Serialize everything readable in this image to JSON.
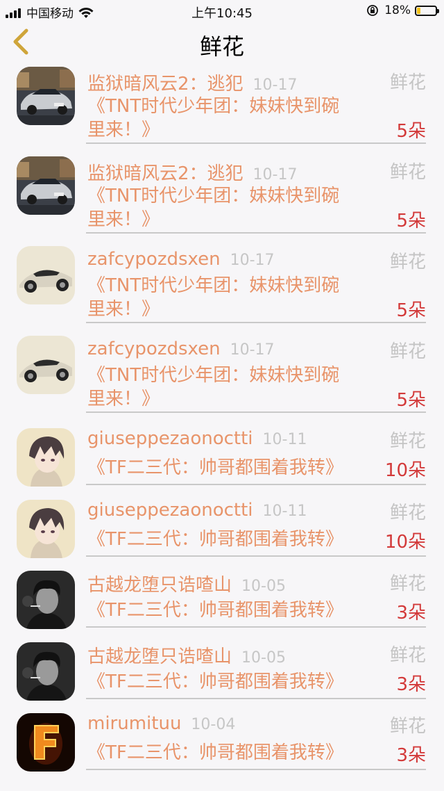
{
  "status_bar": {
    "carrier": "中国移动",
    "time": "上午10:45",
    "battery_percent": "18%",
    "battery_level": 0.18
  },
  "nav": {
    "title": "鲜花",
    "back_icon": "chevron-left-icon",
    "accent": "#cfa53a"
  },
  "colors": {
    "name": "#e8946a",
    "content": "#e8946a",
    "count": "#d33a3a",
    "muted": "#c4c4c4"
  },
  "rows": [
    {
      "name": "监狱暗风云2：逃犯",
      "date": "10-17",
      "gift": "鲜花",
      "content1": "《TNT时代少年团：妹妹快到碗",
      "content2": "里来！》",
      "count": "5朵",
      "avatar": "car-silver-avatar"
    },
    {
      "name": "监狱暗风云2：逃犯",
      "date": "10-17",
      "gift": "鲜花",
      "content1": "《TNT时代少年团：妹妹快到碗",
      "content2": "里来！》",
      "count": "5朵",
      "avatar": "car-silver-avatar"
    },
    {
      "name": "zafcypozdsxen",
      "date": "10-17",
      "gift": "鲜花",
      "content1": "《TNT时代少年团：妹妹快到碗",
      "content2": "里来！》",
      "count": "5朵",
      "avatar": "car-sport-avatar"
    },
    {
      "name": "zafcypozdsxen",
      "date": "10-17",
      "gift": "鲜花",
      "content1": "《TNT时代少年团：妹妹快到碗",
      "content2": "里来！》",
      "count": "5朵",
      "avatar": "car-sport-avatar"
    },
    {
      "name": "giuseppezaonoctti",
      "date": "10-11",
      "gift": "鲜花",
      "content1": "《TF二三代：帅哥都围着我转》",
      "content2": "",
      "count": "10朵",
      "avatar": "anime-boy-avatar"
    },
    {
      "name": "giuseppezaonoctti",
      "date": "10-11",
      "gift": "鲜花",
      "content1": "《TF二三代：帅哥都围着我转》",
      "content2": "",
      "count": "10朵",
      "avatar": "anime-boy-avatar"
    },
    {
      "name": "古越龙堕只诰喳山",
      "date": "10-05",
      "gift": "鲜花",
      "content1": "《TF二三代：帅哥都围着我转》",
      "content2": "",
      "count": "3朵",
      "avatar": "smoking-man-avatar"
    },
    {
      "name": "古越龙堕只诰喳山",
      "date": "10-05",
      "gift": "鲜花",
      "content1": "《TF二三代：帅哥都围着我转》",
      "content2": "",
      "count": "3朵",
      "avatar": "smoking-man-avatar"
    },
    {
      "name": "mirumituu",
      "date": "10-04",
      "gift": "鲜花",
      "content1": "《TF二三代：帅哥都围着我转》",
      "content2": "",
      "count": "3朵",
      "avatar": "fire-letter-avatar"
    }
  ]
}
